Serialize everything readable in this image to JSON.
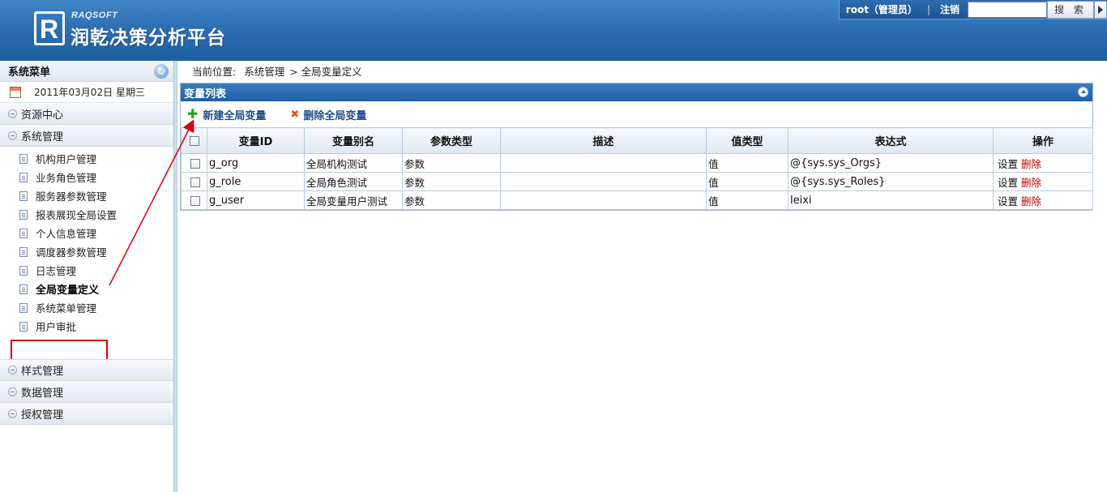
{
  "header": {
    "brand_en": "RAQSOFT",
    "brand_cn": "润乾决策分析平台",
    "logo_glyph": "R",
    "user_label": "root（管理员）",
    "separator": "|",
    "logout": "注销",
    "search_value": "",
    "search_button": "搜 索"
  },
  "sidebar": {
    "title": "系统菜单",
    "date": "2011年03月02日  星期三",
    "groups_top": [
      {
        "label": "资源中心"
      },
      {
        "label": "系统管理"
      }
    ],
    "items": [
      {
        "label": "机构用户管理"
      },
      {
        "label": "业务角色管理"
      },
      {
        "label": "服务器参数管理"
      },
      {
        "label": "报表展现全局设置"
      },
      {
        "label": "个人信息管理"
      },
      {
        "label": "调度器参数管理"
      },
      {
        "label": "日志管理"
      },
      {
        "label": "全局变量定义"
      },
      {
        "label": "系统菜单管理"
      },
      {
        "label": "用户审批"
      }
    ],
    "groups_bottom": [
      {
        "label": "样式管理"
      },
      {
        "label": "数据管理"
      },
      {
        "label": "授权管理"
      }
    ]
  },
  "breadcrumb": {
    "prefix": "当前位置:",
    "part1": "系统管理",
    "part2": "> 全局变量定义"
  },
  "panel": {
    "title": "变量列表",
    "add_button": "新建全局变量",
    "delete_button": "删除全局变量",
    "columns": [
      "变量ID",
      "变量别名",
      "参数类型",
      "描述",
      "值类型",
      "表达式",
      "操作"
    ],
    "rows": [
      {
        "id": "g_org",
        "alias": "全局机构测试",
        "param_type": "参数",
        "desc": "",
        "value_type": "值",
        "expr": "@{sys.sys_Orgs}",
        "op_set": "设置",
        "op_del": "删除"
      },
      {
        "id": "g_role",
        "alias": "全局角色测试",
        "param_type": "参数",
        "desc": "",
        "value_type": "值",
        "expr": "@{sys.sys_Roles}",
        "op_set": "设置",
        "op_del": "删除"
      },
      {
        "id": "g_user",
        "alias": "全局变量用户测试",
        "param_type": "参数",
        "desc": "",
        "value_type": "值",
        "expr": "leixi",
        "op_set": "设置",
        "op_del": "删除"
      }
    ]
  },
  "colors": {
    "header_blue": "#2d6fb3",
    "annotation_red": "#d8000c",
    "delete_red": "#c00000"
  }
}
